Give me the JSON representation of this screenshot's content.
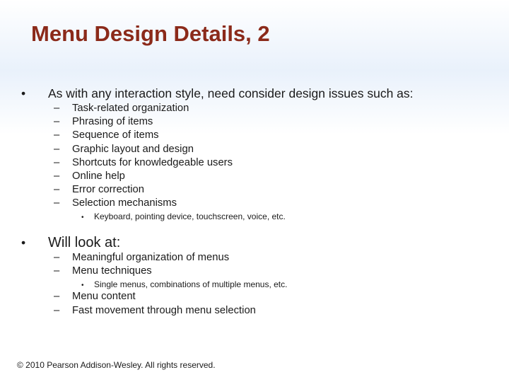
{
  "slide": {
    "title": "Menu Design Details, 2",
    "section1": {
      "bullet": "•",
      "text": "As with any interaction style, need consider design issues such as:",
      "items": [
        "Task-related organization",
        "Phrasing of items",
        "Sequence of items",
        "Graphic layout and design",
        "Shortcuts for knowledgeable users",
        "Online help",
        "Error correction",
        "Selection mechanisms"
      ],
      "subitem": "Keyboard, pointing device, touchscreen, voice, etc."
    },
    "section2": {
      "bullet": "•",
      "text": "Will look at:",
      "items": [
        "Meaningful organization of menus",
        "Menu techniques",
        "Menu content",
        "Fast movement through menu selection"
      ],
      "subitem": "Single menus, combinations of multiple menus, etc."
    },
    "dash": "–",
    "subdot": "•",
    "footer": "© 2010 Pearson Addison-Wesley. All rights reserved."
  }
}
